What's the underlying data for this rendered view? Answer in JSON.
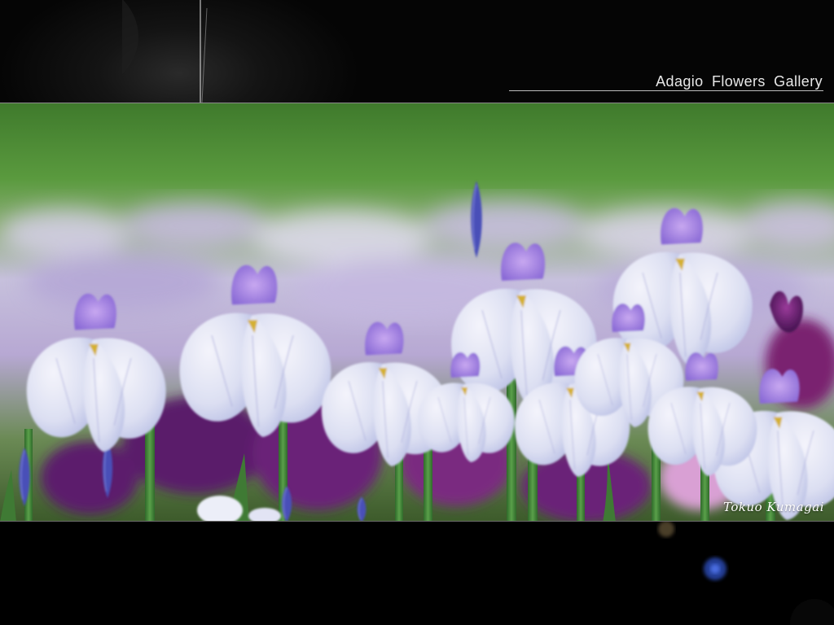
{
  "header": {
    "gallery_title": "Adagio Flowers Gallery"
  },
  "photo": {
    "signature": "Tokuo Kumagai"
  },
  "colors": {
    "background": "#000000",
    "title_text": "#e8e8e8",
    "foliage_green": "#4c8a35",
    "iris_petal": "#e6e8f6",
    "iris_center": "#9a7ee0",
    "iris_dark": "#5a1e6a"
  }
}
